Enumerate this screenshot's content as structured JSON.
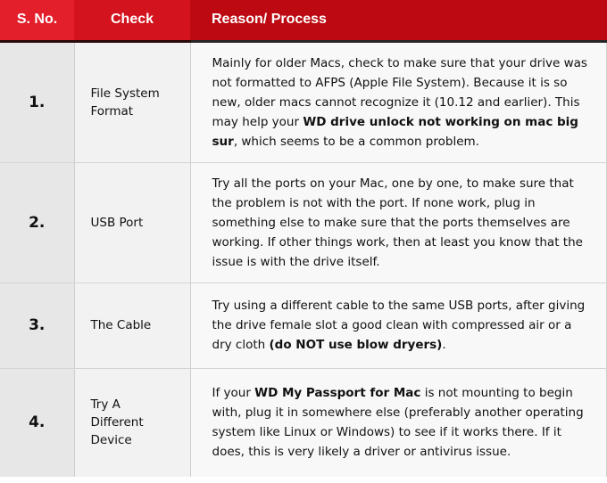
{
  "header": {
    "col_sno": "S. No.",
    "col_check": "Check",
    "col_reason": "Reason/ Process"
  },
  "colors": {
    "header_sno": "#e21f2b",
    "header_check": "#d3131d",
    "header_reason": "#bd0a12"
  },
  "rows": [
    {
      "sno": "1.",
      "check": "File System Format",
      "reason": [
        {
          "text": "Mainly for older Macs, check to make sure that your drive was not formatted to AFPS (Apple File System). Because it is so new, older macs cannot recognize it (10.12 and earlier). This may help your ",
          "bold": false
        },
        {
          "text": "WD drive unlock not working on mac big sur",
          "bold": true
        },
        {
          "text": ", which seems to be a common problem.",
          "bold": false
        }
      ]
    },
    {
      "sno": "2.",
      "check": "USB Port",
      "reason": [
        {
          "text": "Try all the ports on your Mac, one by one, to make sure that the problem is not with the port. If none work, plug in something else to make sure that the ports themselves are working. If other things work, then at least you know that the issue is with the drive itself.",
          "bold": false
        }
      ]
    },
    {
      "sno": "3.",
      "check": "The Cable",
      "reason": [
        {
          "text": "Try using a different cable to the same USB ports, after giving the drive female slot a good clean with compressed air or a dry cloth ",
          "bold": false
        },
        {
          "text": "(do NOT use blow dryers)",
          "bold": true
        },
        {
          "text": ".",
          "bold": false
        }
      ]
    },
    {
      "sno": "4.",
      "check": "Try A Different Device",
      "reason": [
        {
          "text": "If your ",
          "bold": false
        },
        {
          "text": "WD My Passport for Mac",
          "bold": true
        },
        {
          "text": " is not mounting to begin with, plug it in somewhere else (preferably another operating system like Linux or Windows) to see if it works there. If it does, this is very likely a driver or antivirus issue.",
          "bold": false
        }
      ]
    }
  ]
}
